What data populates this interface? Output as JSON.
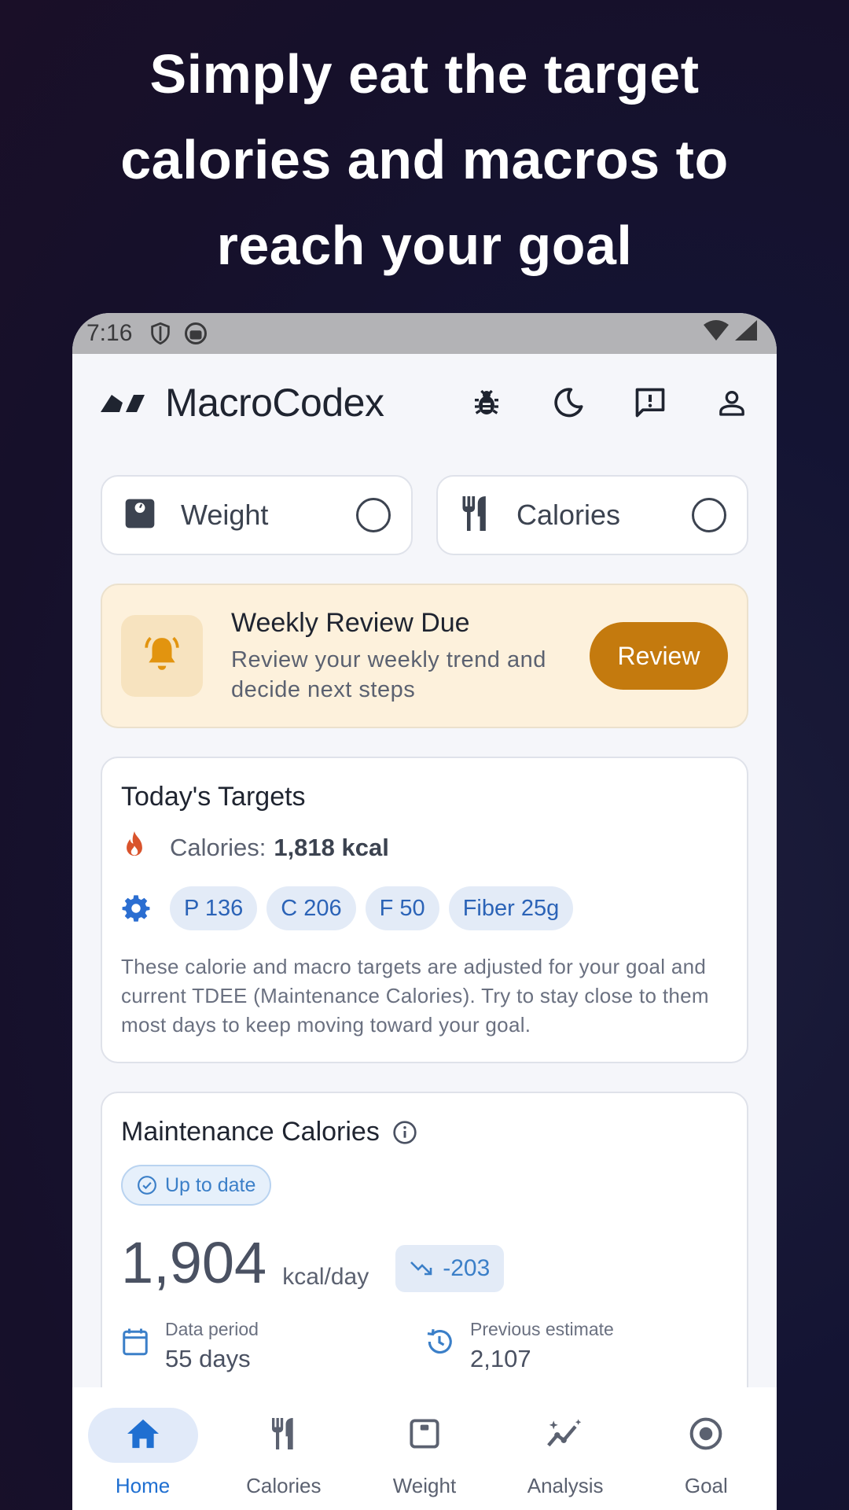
{
  "headline": {
    "line1": "Simply eat the target",
    "line2": "calories and macros to",
    "line3": "reach your goal"
  },
  "status_bar": {
    "time": "7:16"
  },
  "app": {
    "title": "MacroCodex",
    "actions": [
      "bug-icon",
      "moon-icon",
      "feedback-icon",
      "account-icon"
    ]
  },
  "quick_log": [
    {
      "label": "Weight",
      "icon": "scale-icon"
    },
    {
      "label": "Calories",
      "icon": "fork-knife-icon"
    }
  ],
  "weekly_review": {
    "title": "Weekly Review Due",
    "subtitle_line1": "Review your weekly trend and",
    "subtitle_line2": "decide next steps",
    "button": "Review"
  },
  "targets": {
    "title": "Today's Targets",
    "calories_label": "Calories:",
    "calories_value": "1,818 kcal",
    "macros": [
      "P 136",
      "C 206",
      "F 50",
      "Fiber 25g"
    ],
    "description": "These calorie and macro targets are adjusted for your goal and current TDEE (Maintenance Calories). Try to stay close to them most days to keep moving toward your goal."
  },
  "maintenance": {
    "title": "Maintenance Calories",
    "status": "Up to date",
    "value": "1,904",
    "unit": "kcal/day",
    "change": "-203",
    "data_period_label": "Data period",
    "data_period_value": "55 days",
    "previous_label": "Previous estimate",
    "previous_value": "2,107"
  },
  "nav": [
    {
      "label": "Home",
      "active": true
    },
    {
      "label": "Calories",
      "active": false
    },
    {
      "label": "Weight",
      "active": false
    },
    {
      "label": "Analysis",
      "active": false
    },
    {
      "label": "Goal",
      "active": false
    }
  ],
  "colors": {
    "accent": "#1f6fd1",
    "review_button": "#c47a0e",
    "review_bg": "#fdf1dc",
    "chip_bg": "#e3ebf7"
  }
}
